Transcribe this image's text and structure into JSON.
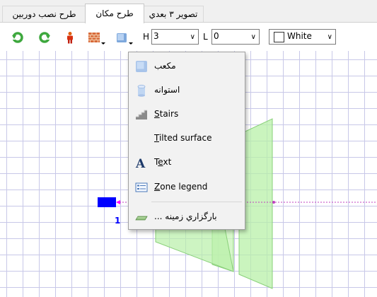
{
  "tabs": [
    {
      "label": "تصوير ۳ بعدي",
      "active": false
    },
    {
      "label": "طرح مكان",
      "active": true
    },
    {
      "label": "طرح نصب دوربين",
      "active": false
    }
  ],
  "toolbar": {
    "h_label": "H",
    "h_value": "3",
    "l_label": "L",
    "l_value": "0",
    "color_value": "White",
    "buttons": [
      "rotate-left-icon",
      "rotate-right-icon",
      "person-icon",
      "brick-wall-icon",
      "cube-icon"
    ]
  },
  "canvas": {
    "marker_label": "1",
    "grid_color": "#c8c8e8",
    "shape_color": "#b8f0a8",
    "marker_color": "#0000ff"
  },
  "menu": {
    "items": [
      {
        "label": "مكعب",
        "icon": "cube-icon"
      },
      {
        "label": "استوانه",
        "icon": "cylinder-icon"
      },
      {
        "label_first": "S",
        "label_rest": "tairs",
        "icon": "stairs-icon"
      },
      {
        "label_first": "T",
        "label_rest": "ilted surface",
        "icon": "tilted-surface-icon"
      },
      {
        "label_pre": "T",
        "label_u": "e",
        "label_post": "xt",
        "icon": "text-icon"
      },
      {
        "label_first": "Z",
        "label_rest": "one legend",
        "icon": "zone-legend-icon"
      },
      {
        "label": "... بارگزاري زمينه",
        "icon": "load-background-icon"
      }
    ]
  }
}
